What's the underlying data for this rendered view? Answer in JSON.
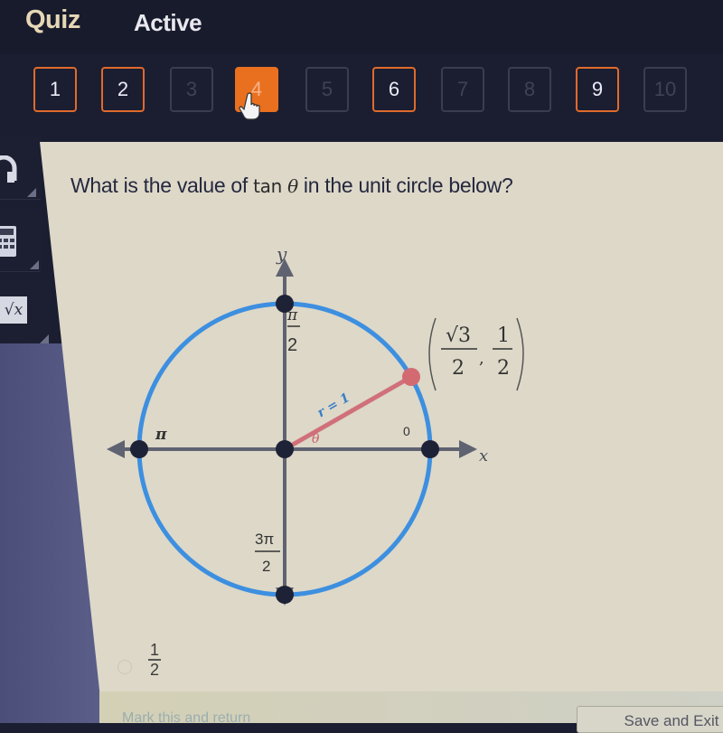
{
  "header": {
    "title": "Quiz",
    "status": "Active"
  },
  "question_nav": {
    "buttons": [
      {
        "label": "1",
        "state": "answered"
      },
      {
        "label": "2",
        "state": "answered"
      },
      {
        "label": "3",
        "state": "unanswered"
      },
      {
        "label": "4",
        "state": "current"
      },
      {
        "label": "5",
        "state": "unanswered"
      },
      {
        "label": "6",
        "state": "answered"
      },
      {
        "label": "7",
        "state": "unanswered"
      },
      {
        "label": "8",
        "state": "unanswered"
      },
      {
        "label": "9",
        "state": "answered"
      },
      {
        "label": "10",
        "state": "unanswered"
      }
    ]
  },
  "sidebar": {
    "tools": [
      {
        "name": "audio",
        "icon": "headphones-icon"
      },
      {
        "name": "calculator",
        "icon": "calculator-icon"
      },
      {
        "name": "formula",
        "icon": "square-root-icon",
        "label": "√x"
      }
    ]
  },
  "question": {
    "prefix": "What is the value of ",
    "tan": "tan",
    "theta": "θ",
    "suffix": " in the unit circle below?"
  },
  "figure": {
    "axis_x": "x",
    "axis_y": "y",
    "label_pi_over_2_num": "π",
    "label_pi_over_2_den": "2",
    "label_pi": "π",
    "label_zero": "0",
    "label_3pi_over_2_num": "3π",
    "label_3pi_over_2_den": "2",
    "radius_label": "r = 1",
    "angle_label": "θ",
    "point_x_num": "√3",
    "point_x_den": "2",
    "point_sep": ",",
    "point_y_num": "1",
    "point_y_den": "2",
    "angle_degrees": 30,
    "colors": {
      "circle": "#3d8fe0",
      "radius": "#d0707a",
      "axis": "#5f6270",
      "point": "#1e2236",
      "highlight_point": "#d36a72"
    }
  },
  "answers": [
    {
      "numerator": "1",
      "denominator": "2",
      "selected": false
    }
  ],
  "footer": {
    "mark_label": "Mark this and return",
    "save_label": "Save and Exit"
  }
}
